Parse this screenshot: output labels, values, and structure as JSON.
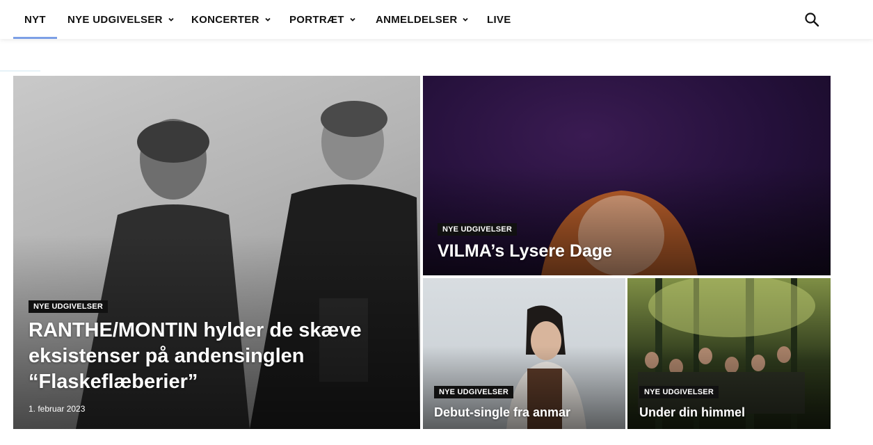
{
  "nav": {
    "items": [
      {
        "label": "NYT",
        "dropdown": false,
        "active": true
      },
      {
        "label": "NYE UDGIVELSER",
        "dropdown": true,
        "active": false
      },
      {
        "label": "KONCERTER",
        "dropdown": true,
        "active": false
      },
      {
        "label": "PORTRÆT",
        "dropdown": true,
        "active": false
      },
      {
        "label": "ANMELDELSER",
        "dropdown": true,
        "active": false
      },
      {
        "label": "LIVE",
        "dropdown": false,
        "active": false
      }
    ],
    "search_icon": "search-icon",
    "accent": "#7c9fe6"
  },
  "articles": [
    {
      "category": "NYE UDGIVELSER",
      "title_lines": [
        "RANTHE/MONTIN hylder de skæve",
        "eksistenser på andensinglen",
        "“Flaskeflæberier”"
      ],
      "date": "1. februar 2023"
    },
    {
      "category": "NYE UDGIVELSER",
      "title": "VILMA’s Lysere Dage"
    },
    {
      "category": "NYE UDGIVELSER",
      "title": "Debut-single fra anmar"
    },
    {
      "category": "NYE UDGIVELSER",
      "title": "Under din himmel"
    }
  ]
}
